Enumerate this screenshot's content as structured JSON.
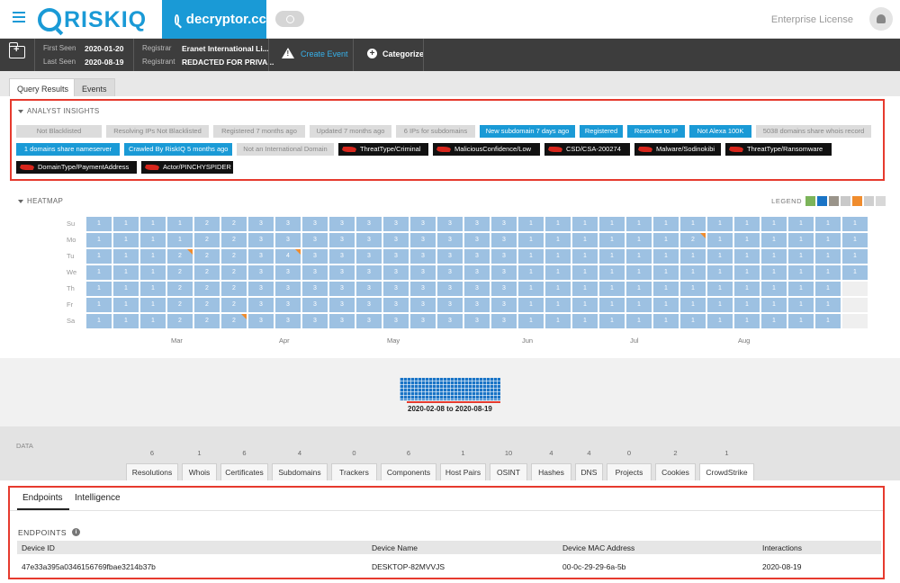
{
  "header": {
    "logo_text": "RISKIQ",
    "search_query": "decryptor.cc",
    "license": "Enterprise License"
  },
  "infobar": {
    "first_seen_label": "First Seen",
    "first_seen": "2020-01-20",
    "last_seen_label": "Last Seen",
    "last_seen": "2020-08-19",
    "registrar_label": "Registrar",
    "registrar": "Eranet International Li...",
    "registrant_label": "Registrant",
    "registrant": "REDACTED FOR PRIVA...",
    "create_event": "Create Event",
    "categorize": "Categorize"
  },
  "query_tabs": [
    "Query Results",
    "Events"
  ],
  "insights": {
    "title": "ANALYST INSIGHTS",
    "row1": [
      {
        "text": "Not Blacklisted",
        "style": "grey"
      },
      {
        "text": "Resolving IPs Not Blacklisted",
        "style": "grey"
      },
      {
        "text": "Registered 7 months ago",
        "style": "grey"
      },
      {
        "text": "Updated 7 months ago",
        "style": "grey"
      },
      {
        "text": "6 IPs for subdomains",
        "style": "grey"
      },
      {
        "text": "New subdomain 7 days ago",
        "style": "blue"
      },
      {
        "text": "Registered",
        "style": "blue"
      },
      {
        "text": "Resolves to IP",
        "style": "blue"
      },
      {
        "text": "Not Alexa 100K",
        "style": "blue"
      },
      {
        "text": "5038 domains share whois record",
        "style": "grey"
      }
    ],
    "row2": [
      {
        "text": "1 domains share nameserver",
        "style": "blue"
      },
      {
        "text": "Crawled By RiskIQ 5 months ago",
        "style": "blue"
      },
      {
        "text": "Not an International Domain",
        "style": "grey"
      },
      {
        "text": "ThreatType/Criminal",
        "style": "dark"
      },
      {
        "text": "MaliciousConfidence/Low",
        "style": "dark"
      },
      {
        "text": "CSD/CSA-200274",
        "style": "dark"
      },
      {
        "text": "Malware/Sodinokibi",
        "style": "dark"
      },
      {
        "text": "ThreatType/Ransomware",
        "style": "dark"
      }
    ],
    "row3": [
      {
        "text": "DomainType/PaymentAddress",
        "style": "dark"
      },
      {
        "text": "Actor/PINCHYSPIDER",
        "style": "dark"
      }
    ]
  },
  "heatmap": {
    "title": "HEATMAP",
    "legend_label": "LEGEND",
    "legend_colors": [
      "#7cb45a",
      "#1a74c6",
      "#9a948a",
      "#c9c9c9",
      "#f08c2d",
      "#cfcfcf",
      "#d8d8d8"
    ],
    "days": [
      "Su",
      "Mo",
      "Tu",
      "We",
      "Th",
      "Fr",
      "Sa"
    ],
    "months": [
      {
        "label": "Mar",
        "col": 3
      },
      {
        "label": "Apr",
        "col": 7
      },
      {
        "label": "May",
        "col": 11
      },
      {
        "label": "Jun",
        "col": 16
      },
      {
        "label": "Jul",
        "col": 20
      },
      {
        "label": "Aug",
        "col": 24
      }
    ],
    "weeks": [
      [
        "1",
        "1",
        "1",
        "1",
        "1",
        "1",
        "1"
      ],
      [
        "1",
        "1",
        "1",
        "1",
        "1",
        "1",
        "1"
      ],
      [
        "1",
        "1",
        "1",
        "1",
        "1",
        "1",
        "1"
      ],
      [
        "1",
        "1",
        "2",
        "2",
        "2",
        "2",
        "2"
      ],
      [
        "2",
        "2",
        "2",
        "2",
        "2",
        "2",
        "2"
      ],
      [
        "2",
        "2",
        "2",
        "2",
        "2",
        "2",
        "2"
      ],
      [
        "3",
        "3",
        "3",
        "3",
        "3",
        "3",
        "3"
      ],
      [
        "3",
        "3",
        "4",
        "3",
        "3",
        "3",
        "3"
      ],
      [
        "3",
        "3",
        "3",
        "3",
        "3",
        "3",
        "3"
      ],
      [
        "3",
        "3",
        "3",
        "3",
        "3",
        "3",
        "3"
      ],
      [
        "3",
        "3",
        "3",
        "3",
        "3",
        "3",
        "3"
      ],
      [
        "3",
        "3",
        "3",
        "3",
        "3",
        "3",
        "3"
      ],
      [
        "3",
        "3",
        "3",
        "3",
        "3",
        "3",
        "3"
      ],
      [
        "3",
        "3",
        "3",
        "3",
        "3",
        "3",
        "3"
      ],
      [
        "3",
        "3",
        "3",
        "3",
        "3",
        "3",
        "3"
      ],
      [
        "3",
        "3",
        "3",
        "3",
        "3",
        "3",
        "3"
      ],
      [
        "1",
        "1",
        "1",
        "1",
        "1",
        "1",
        "1"
      ],
      [
        "1",
        "1",
        "1",
        "1",
        "1",
        "1",
        "1"
      ],
      [
        "1",
        "1",
        "1",
        "1",
        "1",
        "1",
        "1"
      ],
      [
        "1",
        "1",
        "1",
        "1",
        "1",
        "1",
        "1"
      ],
      [
        "1",
        "1",
        "1",
        "1",
        "1",
        "1",
        "1"
      ],
      [
        "1",
        "1",
        "1",
        "1",
        "1",
        "1",
        "1"
      ],
      [
        "1",
        "2",
        "1",
        "1",
        "1",
        "1",
        "1"
      ],
      [
        "1",
        "1",
        "1",
        "1",
        "1",
        "1",
        "1"
      ],
      [
        "1",
        "1",
        "1",
        "1",
        "1",
        "1",
        "1"
      ],
      [
        "1",
        "1",
        "1",
        "1",
        "1",
        "1",
        "1"
      ],
      [
        "1",
        "1",
        "1",
        "1",
        "1",
        "1",
        "1"
      ],
      [
        "1",
        "1",
        "1",
        "1",
        "1",
        "1",
        "1"
      ],
      [
        "1",
        "1",
        "1",
        "1",
        "",
        "",
        ""
      ]
    ],
    "flags": [
      [
        3,
        2
      ],
      [
        5,
        6
      ],
      [
        7,
        2
      ],
      [
        22,
        1
      ]
    ]
  },
  "timeline": {
    "range": "2020-02-08 to 2020-08-19"
  },
  "data_section": {
    "label": "DATA",
    "tabs": [
      {
        "label": "Resolutions",
        "count": "6"
      },
      {
        "label": "Whois",
        "count": "1"
      },
      {
        "label": "Certificates",
        "count": "6"
      },
      {
        "label": "Subdomains",
        "count": "4"
      },
      {
        "label": "Trackers",
        "count": "0"
      },
      {
        "label": "Components",
        "count": "6"
      },
      {
        "label": "Host Pairs",
        "count": "1"
      },
      {
        "label": "OSINT",
        "count": "10"
      },
      {
        "label": "Hashes",
        "count": "4"
      },
      {
        "label": "DNS",
        "count": "4"
      },
      {
        "label": "Projects",
        "count": "0"
      },
      {
        "label": "Cookies",
        "count": "2"
      },
      {
        "label": "CrowdStrike",
        "count": "1"
      }
    ]
  },
  "crowdstrike": {
    "subtabs": [
      "Endpoints",
      "Intelligence"
    ],
    "section_title": "ENDPOINTS",
    "columns": [
      "Device ID",
      "Device Name",
      "Device MAC Address",
      "Interactions"
    ],
    "row": [
      "47e33a395a0346156769fbae3214b37b",
      "DESKTOP-82MVVJS",
      "00-0c-29-29-6a-5b",
      "2020-08-19"
    ]
  }
}
